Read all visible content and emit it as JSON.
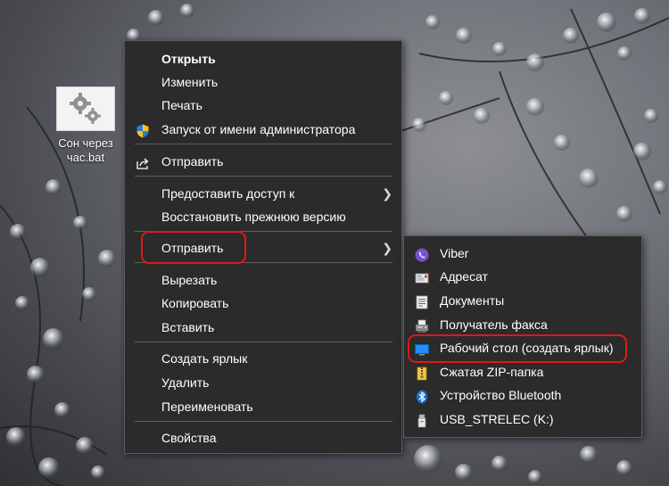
{
  "desktop": {
    "file": {
      "name_line1": "Сон через",
      "name_line2": "час.bat",
      "icon": "gears-batch-file-icon"
    }
  },
  "context_menu": {
    "items": [
      {
        "label": "Открыть",
        "bold": true
      },
      {
        "label": "Изменить"
      },
      {
        "label": "Печать"
      },
      {
        "label": "Запуск от имени администратора",
        "icon": "uac-shield-icon"
      },
      {
        "label": "Отправить",
        "icon": "share-icon"
      },
      {
        "label": "Предоставить доступ к",
        "submenu": true
      },
      {
        "label": "Восстановить прежнюю версию"
      },
      {
        "label": "Отправить",
        "submenu": true,
        "highlighted": true
      },
      {
        "label": "Вырезать"
      },
      {
        "label": "Копировать"
      },
      {
        "label": "Вставить"
      },
      {
        "label": "Создать ярлык"
      },
      {
        "label": "Удалить"
      },
      {
        "label": "Переименовать"
      },
      {
        "label": "Свойства"
      }
    ]
  },
  "send_to_submenu": {
    "items": [
      {
        "label": "Viber",
        "icon": "viber-icon"
      },
      {
        "label": "Адресат",
        "icon": "mail-recipient-icon"
      },
      {
        "label": "Документы",
        "icon": "documents-icon"
      },
      {
        "label": "Получатель факса",
        "icon": "fax-icon"
      },
      {
        "label": "Рабочий стол (создать ярлык)",
        "icon": "desktop-icon",
        "highlighted": true
      },
      {
        "label": "Сжатая ZIP-папка",
        "icon": "zip-folder-icon"
      },
      {
        "label": "Устройство Bluetooth",
        "icon": "bluetooth-icon"
      },
      {
        "label": "USB_STRELEC (K:)",
        "icon": "usb-drive-icon"
      }
    ]
  },
  "colors": {
    "menu_bg": "#2b2b2b",
    "menu_text": "#ffffff",
    "highlight_ring": "#e01818",
    "separator": "#5e5e5e"
  }
}
